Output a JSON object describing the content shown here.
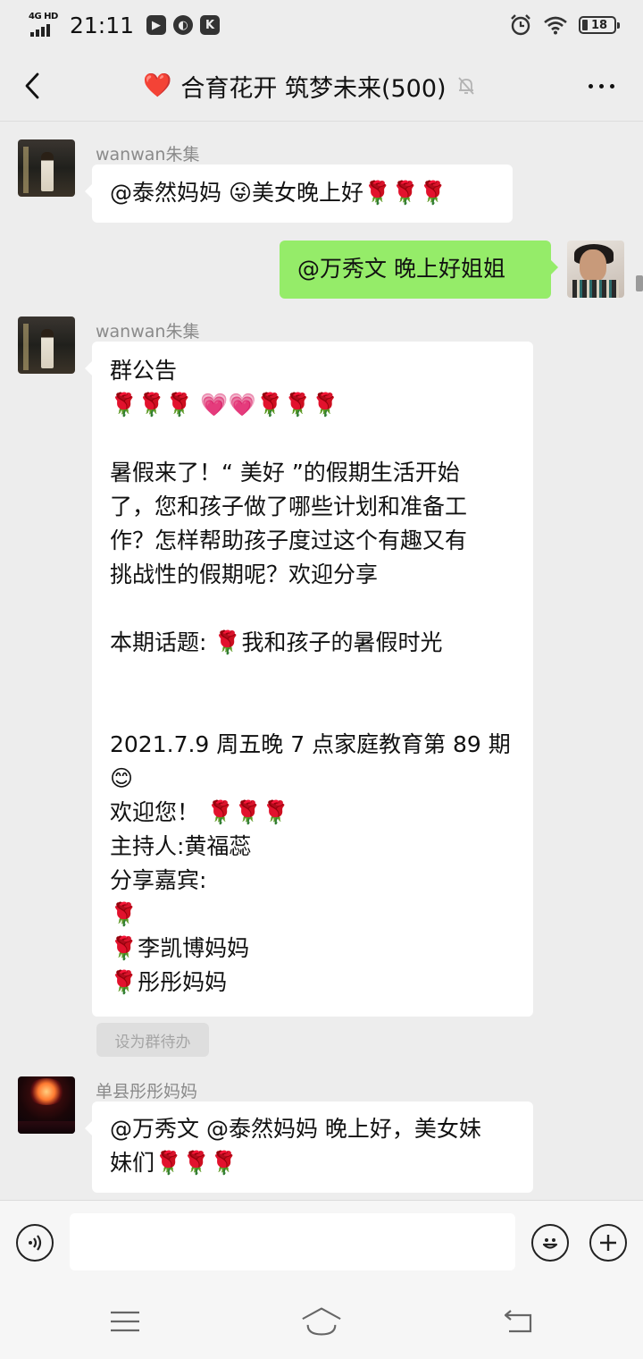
{
  "status_bar": {
    "network": "4G HD",
    "time": "21:11",
    "battery": "18",
    "battery_level": 0.18
  },
  "nav": {
    "title_emoji": "❤️",
    "title": "合育花开 筑梦未来(500)"
  },
  "messages": [
    {
      "sender": "wanwan朱集",
      "lines": [
        "@泰然妈妈 😜美女晚上好🌹🌹🌹"
      ]
    },
    {
      "self": true,
      "lines": [
        "@万秀文  晚上好姐姐"
      ]
    },
    {
      "sender": "wanwan朱集",
      "lines": [
        "群公告",
        "🌹🌹🌹 💗💗🌹🌹🌹",
        "",
        "暑假来了！“ 美好 ”的假期生活开始",
        "了，您和孩子做了哪些计划和准备工",
        "作？怎样帮助孩子度过这个有趣又有",
        "挑战性的假期呢？欢迎分享",
        "",
        "本期话题: 🌹我和孩子的暑假时光",
        "",
        "",
        "2021.7.9 周五晚 7 点家庭教育第 89 期",
        "😊",
        "欢迎您！ 🌹🌹🌹",
        "主持人:黄福蕊",
        "分享嘉宾:",
        "🌹",
        "🌹李凯博妈妈",
        "🌹彤彤妈妈"
      ],
      "action_chip": "设为群待办"
    },
    {
      "sender": "单县彤彤妈妈",
      "lines": [
        "@万秀文 @泰然妈妈  晚上好，美女妹",
        "妹们🌹🌹🌹"
      ]
    }
  ],
  "input_bar": {
    "placeholder": "",
    "voice_icon": "voice-icon",
    "emoji_icon": "emoji-icon",
    "plus_icon": "plus-icon"
  },
  "system_nav": {
    "icons": [
      "menu-icon",
      "home-icon",
      "back-icon"
    ]
  },
  "colors": {
    "background": "#ededed",
    "self_bubble": "#95ec69",
    "other_bubble": "#ffffff",
    "sender_name": "#8a8a8a"
  }
}
